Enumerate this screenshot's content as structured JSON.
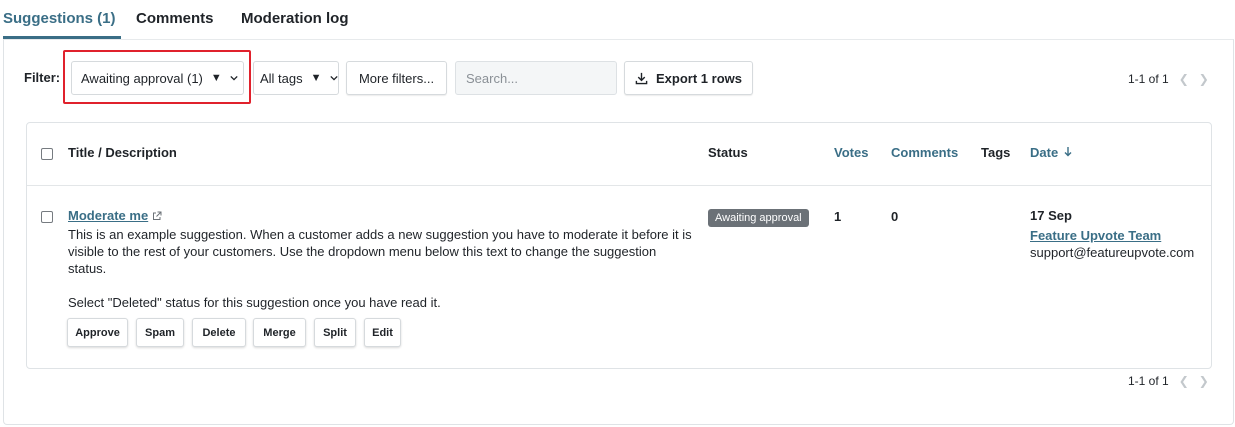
{
  "tabs": [
    {
      "label": "Suggestions (1)",
      "active": true
    },
    {
      "label": "Comments",
      "active": false
    },
    {
      "label": "Moderation log",
      "active": false
    }
  ],
  "filter": {
    "label": "Filter:",
    "status_value": "Awaiting approval (1)",
    "tags_value": "All tags",
    "more_filters_label": "More filters...",
    "search_placeholder": "Search...",
    "export_label": "Export 1 rows"
  },
  "pagination": {
    "top": "1-1 of 1",
    "bottom": "1-1 of 1",
    "prev_icon": "chevron-left-icon",
    "next_icon": "chevron-right-icon"
  },
  "table": {
    "headers": {
      "title": "Title / Description",
      "status": "Status",
      "votes": "Votes",
      "comments": "Comments",
      "tags": "Tags",
      "date": "Date"
    },
    "rows": [
      {
        "title": "Moderate me",
        "description": "This is an example suggestion. When a customer adds a new suggestion you have to moderate it before it is visible to the rest of your customers. Use the dropdown menu below this text to change the suggestion status.",
        "description_2": "Select \"Deleted\" status for this suggestion once you have read it.",
        "status": "Awaiting approval",
        "votes": "1",
        "comments": "0",
        "tags": "",
        "date": "17 Sep",
        "author": "Feature Upvote Team",
        "email": "support@featureupvote.com",
        "actions": [
          "Approve",
          "Spam",
          "Delete",
          "Merge",
          "Split",
          "Edit"
        ]
      }
    ]
  },
  "colors": {
    "accent": "#3a6e86",
    "highlight": "#e0212c",
    "badge_bg": "#6b7177"
  }
}
